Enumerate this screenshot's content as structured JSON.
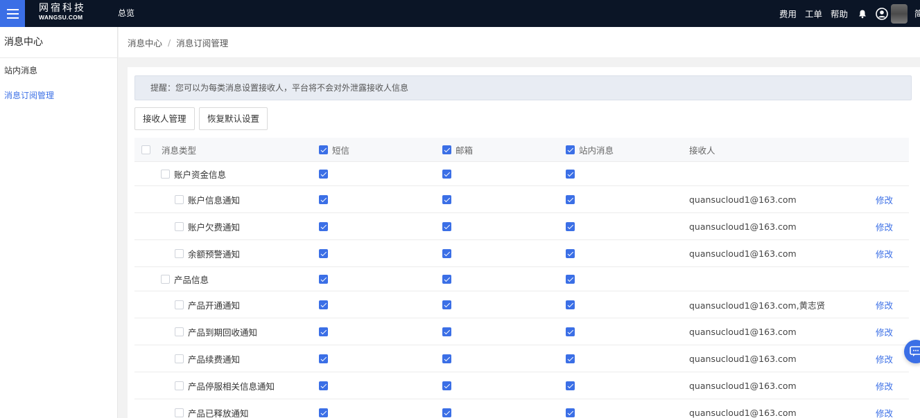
{
  "topbar": {
    "logo_cn": "网宿科技",
    "logo_en": "WANGSU.COM",
    "overview": "总览",
    "links": [
      "费用",
      "工单",
      "帮助"
    ],
    "lang": "简"
  },
  "sidebar": {
    "title": "消息中心",
    "items": [
      {
        "label": "站内消息",
        "active": false
      },
      {
        "label": "消息订阅管理",
        "active": true
      }
    ]
  },
  "breadcrumb": {
    "root": "消息中心",
    "sep": "/",
    "current": "消息订阅管理"
  },
  "notice": "提醒：您可以为每类消息设置接收人，平台将不会对外泄露接收人信息",
  "buttons": {
    "receivers": "接收人管理",
    "restore": "恢复默认设置"
  },
  "table": {
    "headers": {
      "type": "消息类型",
      "sms": "短信",
      "email": "邮箱",
      "inbox": "站内消息",
      "receiver": "接收人"
    },
    "rows": [
      {
        "level": 1,
        "name": "账户资金信息",
        "receiver": "",
        "action": ""
      },
      {
        "level": 2,
        "name": "账户信息通知",
        "receiver": "quansucloud1@163.com",
        "action": "修改"
      },
      {
        "level": 2,
        "name": "账户欠费通知",
        "receiver": "quansucloud1@163.com",
        "action": "修改"
      },
      {
        "level": 2,
        "name": "余额预警通知",
        "receiver": "quansucloud1@163.com",
        "action": "修改"
      },
      {
        "level": 1,
        "name": "产品信息",
        "receiver": "",
        "action": ""
      },
      {
        "level": 2,
        "name": "产品开通通知",
        "receiver": "quansucloud1@163.com,黄志贤",
        "action": "修改"
      },
      {
        "level": 2,
        "name": "产品到期回收通知",
        "receiver": "quansucloud1@163.com",
        "action": "修改"
      },
      {
        "level": 2,
        "name": "产品续费通知",
        "receiver": "quansucloud1@163.com",
        "action": "修改"
      },
      {
        "level": 2,
        "name": "产品停服相关信息通知",
        "receiver": "quansucloud1@163.com",
        "action": "修改"
      },
      {
        "level": 2,
        "name": "产品已释放通知",
        "receiver": "quansucloud1@163.com",
        "action": "修改"
      }
    ]
  },
  "colors": {
    "accent": "#3b6fe6",
    "topbar": "#0b1526"
  }
}
